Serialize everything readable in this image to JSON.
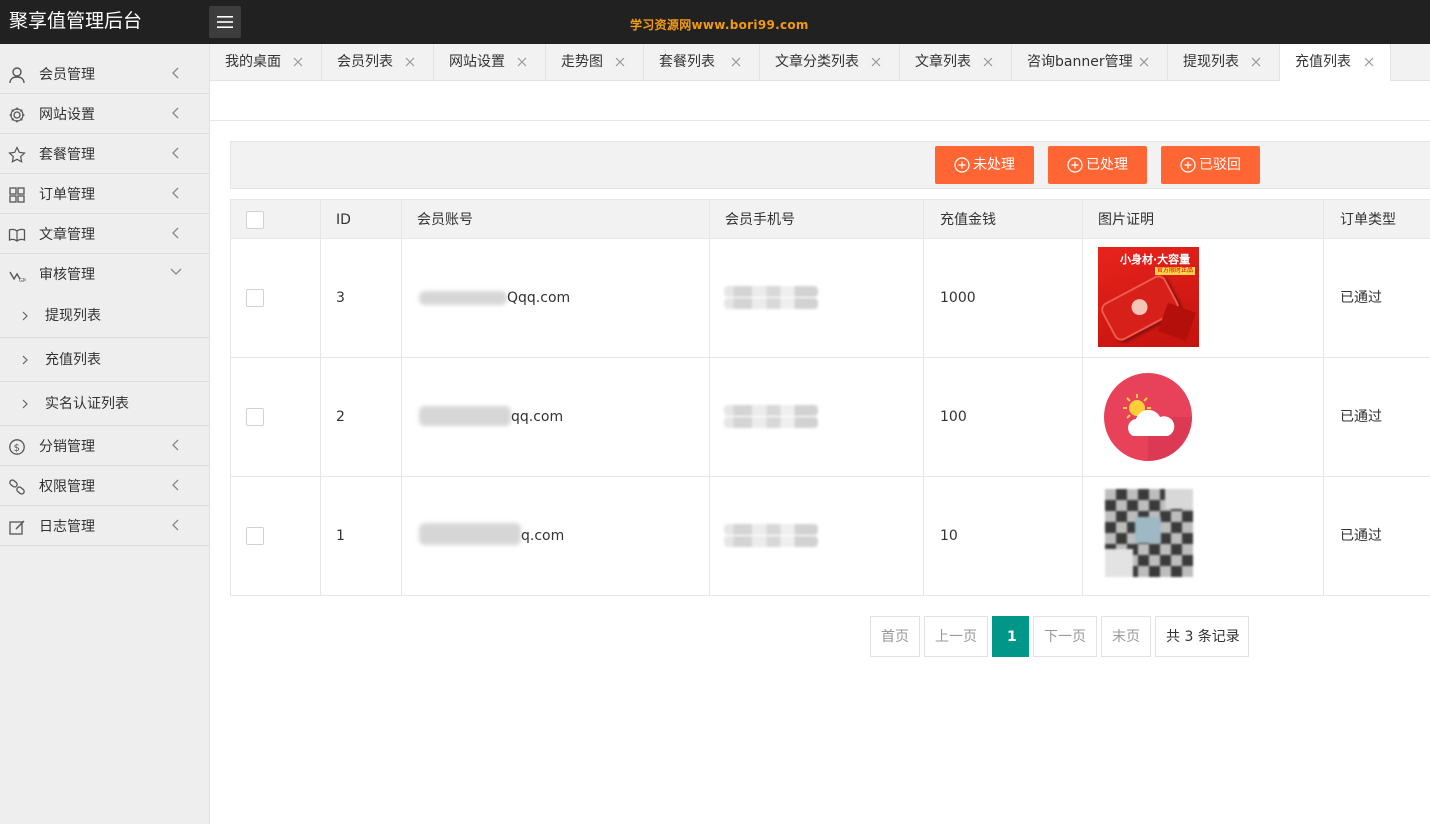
{
  "header": {
    "title": "聚享值管理后台",
    "watermark": "学习资源网www.bori99.com",
    "menu_icon": "hamburger-menu-icon"
  },
  "sidebar": {
    "items": [
      {
        "label": "会员管理",
        "icon": "user-icon"
      },
      {
        "label": "网站设置",
        "icon": "gear-icon"
      },
      {
        "label": "套餐管理",
        "icon": "star-icon"
      },
      {
        "label": "订单管理",
        "icon": "grid-icon"
      },
      {
        "label": "文章管理",
        "icon": "book-icon"
      },
      {
        "label": "审核管理",
        "icon": "audit-icon",
        "expanded": true
      },
      {
        "label": "分销管理",
        "icon": "dollar-icon"
      },
      {
        "label": "权限管理",
        "icon": "link-icon"
      },
      {
        "label": "日志管理",
        "icon": "edit-icon"
      }
    ],
    "sub_items": [
      {
        "label": "提现列表"
      },
      {
        "label": "充值列表"
      },
      {
        "label": "实名认证列表"
      }
    ]
  },
  "tabs": [
    {
      "label": "我的桌面"
    },
    {
      "label": "会员列表"
    },
    {
      "label": "网站设置"
    },
    {
      "label": "走势图"
    },
    {
      "label": "套餐列表"
    },
    {
      "label": "文章分类列表"
    },
    {
      "label": "文章列表"
    },
    {
      "label": "咨询banner管理"
    },
    {
      "label": "提现列表"
    },
    {
      "label": "充值列表",
      "active": true
    }
  ],
  "toolbar": {
    "buttons": [
      {
        "label": "未处理"
      },
      {
        "label": "已处理"
      },
      {
        "label": "已驳回"
      }
    ],
    "accent": "#ff6633"
  },
  "table": {
    "columns": [
      "ID",
      "会员账号",
      "会员手机号",
      "充值金钱",
      "图片证明",
      "订单类型"
    ],
    "rows": [
      {
        "id": "3",
        "account_visible": "Qqq.com",
        "amount": "1000",
        "image": "phone-ad-image",
        "image_text": "小身材·大容量",
        "image_badge": "官方限时正品",
        "type": "已通过"
      },
      {
        "id": "2",
        "account_visible": "qq.com",
        "amount": "100",
        "image": "weather-icon",
        "type": "已通过"
      },
      {
        "id": "1",
        "account_visible": "q.com",
        "amount": "10",
        "image": "qr-code-image",
        "type": "已通过"
      }
    ]
  },
  "pagination": {
    "first": "首页",
    "prev": "上一页",
    "current": "1",
    "next": "下一页",
    "last": "末页",
    "total": "共 3 条记录",
    "accent": "#009688"
  }
}
